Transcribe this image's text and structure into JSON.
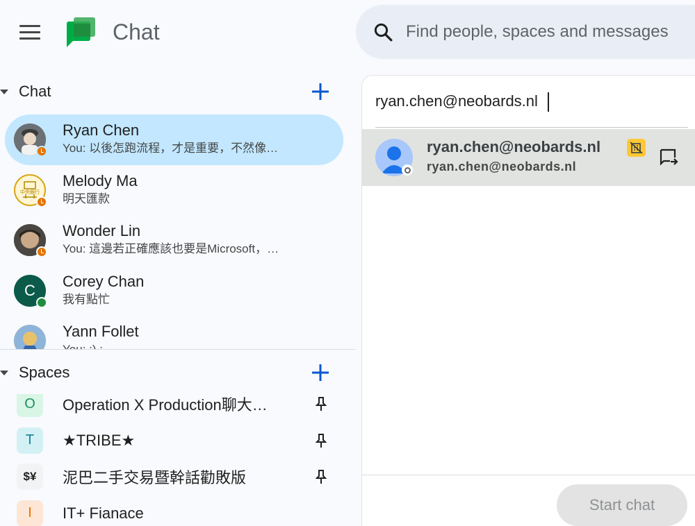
{
  "header": {
    "app_title": "Chat",
    "search_placeholder": "Find people, spaces and messages"
  },
  "chat_section": {
    "title": "Chat",
    "items": [
      {
        "name": "Ryan Chen",
        "preview": "You: 以後怎跑流程，才是重要，不然像…",
        "status": "away",
        "active": true
      },
      {
        "name": "Melody Ma",
        "preview": "明天匯款",
        "status": "away",
        "active": false
      },
      {
        "name": "Wonder Lin",
        "preview": "You: 這邊若正確應該也要是Microsoft，…",
        "status": "away",
        "active": false
      },
      {
        "name": "Corey Chan",
        "preview": "我有點忙",
        "status": "online",
        "avatar_letter": "C",
        "active": false
      },
      {
        "name": "Yann Follet",
        "preview": "You: :) :",
        "status": "offline",
        "active": false
      }
    ]
  },
  "spaces_section": {
    "title": "Spaces",
    "items": [
      {
        "badge": "O",
        "name": "Operation X Production聊大…",
        "badge_bg": "#d8f5e6",
        "badge_color": "#1e8e5e",
        "pinned": true
      },
      {
        "badge": "T",
        "name": "★TRIBE★",
        "badge_bg": "#d3f1f4",
        "badge_color": "#12829a",
        "pinned": true
      },
      {
        "badge": "$¥",
        "name": "泥巴二手交易暨幹話勸敗版",
        "badge_bg": "#f1f3f4",
        "badge_color": "#1f1f1f",
        "pinned": true
      },
      {
        "badge": "I",
        "name": "IT+ Fianace",
        "badge_bg": "#fde6d5",
        "badge_color": "#e37400",
        "pinned": false
      }
    ]
  },
  "new_chat": {
    "to_value": "ryan.chen@neobards.nl",
    "suggestion": {
      "name": "ryan.chen@neobards.nl",
      "email": "ryan.chen@neobards.nl"
    },
    "start_button": "Start chat"
  },
  "colors": {
    "accent": "#0b57d0",
    "active_bg": "#c2e7ff",
    "away": "#e37400",
    "online": "#1e8e3e",
    "external_badge": "#fcc934"
  }
}
